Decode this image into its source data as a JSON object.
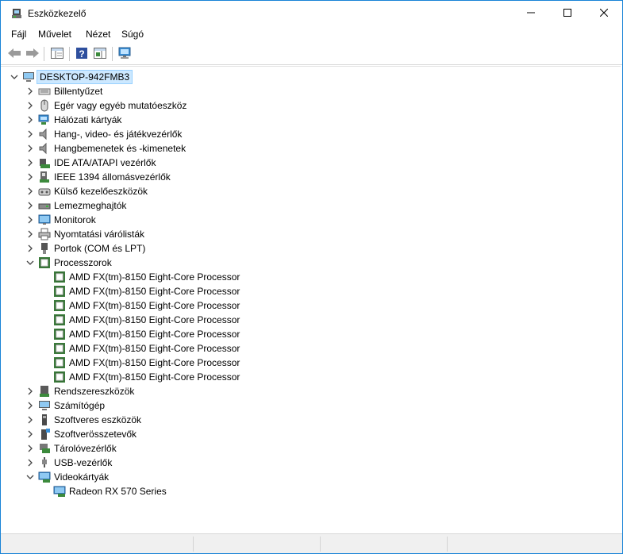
{
  "window": {
    "title": "Eszközkezelő"
  },
  "menu": [
    {
      "label": "Fájl"
    },
    {
      "label": "Művelet"
    },
    {
      "label": "Nézet"
    },
    {
      "label": "Súgó"
    }
  ],
  "toolbar": {
    "buttons": [
      {
        "name": "back-button",
        "icon": "arrow-left-icon"
      },
      {
        "name": "forward-button",
        "icon": "arrow-right-icon"
      },
      {
        "name": "show-hide-console-tree-button",
        "icon": "console-tree-icon"
      },
      {
        "name": "help-button",
        "icon": "help-icon"
      },
      {
        "name": "properties-view-button",
        "icon": "properties-icon"
      },
      {
        "name": "scan-hardware-button",
        "icon": "monitor-scan-icon"
      }
    ]
  },
  "tree": {
    "root": {
      "label": "DESKTOP-942FMB3",
      "expanded": true
    },
    "categories": [
      {
        "label": "Billentyűzet",
        "icon": "keyboard-icon",
        "expanded": false
      },
      {
        "label": "Egér vagy egyéb mutatóeszköz",
        "icon": "mouse-icon",
        "expanded": false
      },
      {
        "label": "Hálózati kártyák",
        "icon": "network-icon",
        "expanded": false
      },
      {
        "label": "Hang-, video- és játékvezérlők",
        "icon": "speaker-icon",
        "expanded": false
      },
      {
        "label": "Hangbemenetek és -kimenetek",
        "icon": "speaker-icon",
        "expanded": false
      },
      {
        "label": "IDE ATA/ATAPI vezérlők",
        "icon": "ide-controller-icon",
        "expanded": false
      },
      {
        "label": "IEEE 1394 állomásvezérlők",
        "icon": "firewire-icon",
        "expanded": false
      },
      {
        "label": "Külső kezelőeszközök",
        "icon": "hid-icon",
        "expanded": false
      },
      {
        "label": "Lemezmeghajtók",
        "icon": "disk-drive-icon",
        "expanded": false
      },
      {
        "label": "Monitorok",
        "icon": "monitor-icon",
        "expanded": false
      },
      {
        "label": "Nyomtatási várólisták",
        "icon": "printer-icon",
        "expanded": false
      },
      {
        "label": "Portok (COM és LPT)",
        "icon": "port-icon",
        "expanded": false
      },
      {
        "label": "Processzorok",
        "icon": "processor-icon",
        "expanded": true,
        "children": [
          {
            "label": "AMD FX(tm)-8150 Eight-Core Processor",
            "icon": "processor-icon"
          },
          {
            "label": "AMD FX(tm)-8150 Eight-Core Processor",
            "icon": "processor-icon"
          },
          {
            "label": "AMD FX(tm)-8150 Eight-Core Processor",
            "icon": "processor-icon"
          },
          {
            "label": "AMD FX(tm)-8150 Eight-Core Processor",
            "icon": "processor-icon"
          },
          {
            "label": "AMD FX(tm)-8150 Eight-Core Processor",
            "icon": "processor-icon"
          },
          {
            "label": "AMD FX(tm)-8150 Eight-Core Processor",
            "icon": "processor-icon"
          },
          {
            "label": "AMD FX(tm)-8150 Eight-Core Processor",
            "icon": "processor-icon"
          },
          {
            "label": "AMD FX(tm)-8150 Eight-Core Processor",
            "icon": "processor-icon"
          }
        ]
      },
      {
        "label": "Rendszereszközök",
        "icon": "system-device-icon",
        "expanded": false
      },
      {
        "label": "Számítógép",
        "icon": "computer-icon",
        "expanded": false
      },
      {
        "label": "Szoftveres eszközök",
        "icon": "software-device-icon",
        "expanded": false
      },
      {
        "label": "Szoftverösszetevők",
        "icon": "software-component-icon",
        "expanded": false
      },
      {
        "label": "Tárolóvezérlők",
        "icon": "storage-controller-icon",
        "expanded": false
      },
      {
        "label": "USB-vezérlők",
        "icon": "usb-icon",
        "expanded": false
      },
      {
        "label": "Videokártyák",
        "icon": "display-adapter-icon",
        "expanded": true,
        "children": [
          {
            "label": "Radeon RX 570 Series",
            "icon": "display-adapter-icon"
          }
        ]
      }
    ]
  },
  "colors": {
    "accent": "#1883d7",
    "selection": "#cce8ff",
    "chip_green": "#3c8a3c"
  }
}
